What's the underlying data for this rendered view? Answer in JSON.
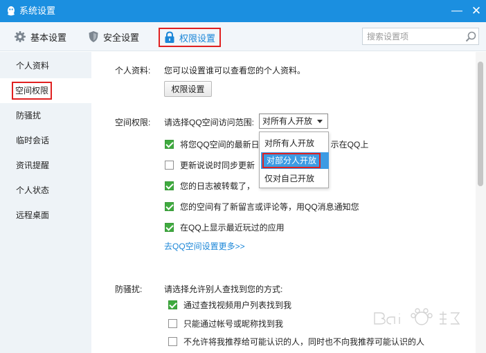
{
  "window": {
    "title": "系统设置",
    "minimize_glyph": "—",
    "close_glyph": "✕",
    "accent": "#1b8fe0"
  },
  "toolbar": {
    "tabs": [
      {
        "label": "基本设置",
        "icon": "gear-icon"
      },
      {
        "label": "安全设置",
        "icon": "shield-icon"
      },
      {
        "label": "权限设置",
        "icon": "lock-icon",
        "active": true
      }
    ],
    "search_placeholder": "搜索设置项"
  },
  "sidebar": {
    "items": [
      {
        "label": "个人资料"
      },
      {
        "label": "空间权限",
        "active": true
      },
      {
        "label": "防骚扰"
      },
      {
        "label": "临时会话"
      },
      {
        "label": "资讯提醒"
      },
      {
        "label": "个人状态"
      },
      {
        "label": "远程桌面"
      }
    ]
  },
  "profile": {
    "label": "个人资料:",
    "desc": "您可以设置谁可以查看您的个人资料。",
    "button": "权限设置"
  },
  "space": {
    "label": "空间权限:",
    "prompt": "请选择QQ空间访问范围:",
    "selected": "对所有人开放",
    "options": [
      "对所有人开放",
      "对部分人开放",
      "仅对自己开放"
    ],
    "checks": [
      {
        "label": "将您QQ空间的最新日",
        "tail": "示在QQ上",
        "checked": true
      },
      {
        "label": "更新说说时同步更新",
        "tail": "",
        "checked": false
      },
      {
        "label": "您的日志被转载了，",
        "tail": "",
        "checked": true
      },
      {
        "label": "您的空间有了新留言或评论等，用QQ消息通知您",
        "tail": "",
        "checked": true
      },
      {
        "label": "在QQ上显示最近玩过的应用",
        "tail": "",
        "checked": true
      }
    ],
    "more_link": "去QQ空间设置更多>>"
  },
  "harass": {
    "label": "防骚扰:",
    "prompt": "请选择允许别人查找到您的方式:",
    "checks": [
      {
        "label": "通过查找视频用户列表找到我",
        "checked": true
      },
      {
        "label": "只能通过帐号或昵称找到我",
        "checked": false
      },
      {
        "label": "不允许将我推荐给可能认识的人，同时也不向我推荐可能认识的人",
        "checked": false
      }
    ]
  }
}
